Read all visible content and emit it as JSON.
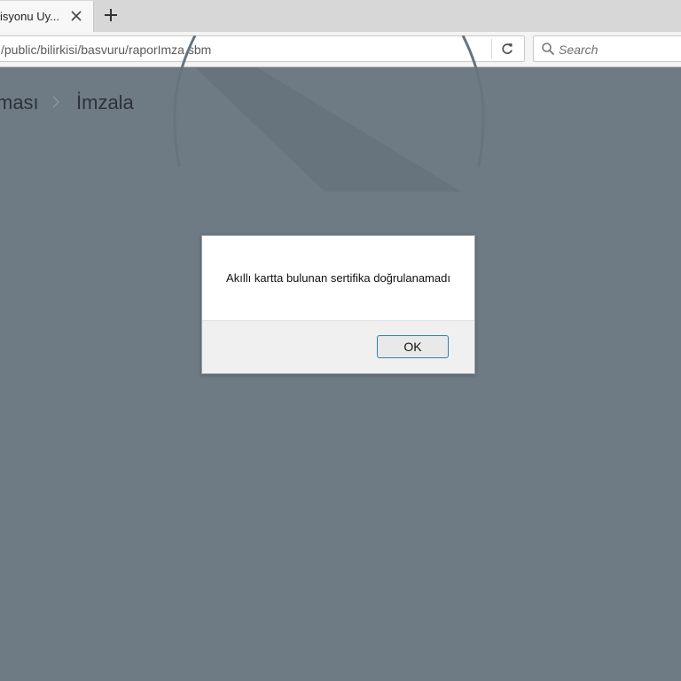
{
  "browser": {
    "tab": {
      "title": "isyonu Uy..."
    },
    "address_bar": {
      "url": "/public/bilirkisi/basvuru/raporImza.sbm"
    },
    "search_bar": {
      "placeholder": "Search"
    }
  },
  "page": {
    "breadcrumb": {
      "previous": "ması",
      "current": "İmzala"
    }
  },
  "dialog": {
    "message": "Akıllı kartta bulunan sertifika doğrulanamadı",
    "ok_label": "OK"
  },
  "colors": {
    "page_background": "#6e7a84",
    "dialog_button_border": "#2f7fb8"
  },
  "icons": {
    "tab_close": "close-icon",
    "new_tab": "plus-icon",
    "reload": "reload-icon",
    "search": "search-icon",
    "breadcrumb_separator": "chevron-right-icon"
  }
}
